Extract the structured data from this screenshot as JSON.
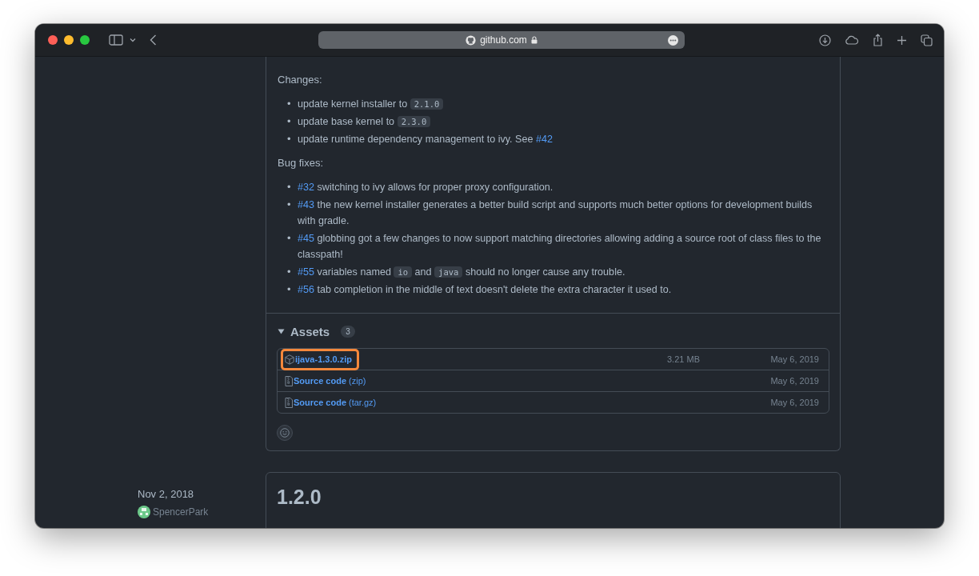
{
  "browser": {
    "address": "github.com"
  },
  "changes": {
    "heading": "Changes:",
    "items": [
      {
        "marker": "•",
        "segments": [
          {
            "kind": "text",
            "text": "update kernel installer to "
          },
          {
            "kind": "code",
            "text": "2.1.0"
          }
        ]
      },
      {
        "marker": "•",
        "segments": [
          {
            "kind": "text",
            "text": "update base kernel to "
          },
          {
            "kind": "code",
            "text": "2.3.0"
          }
        ]
      },
      {
        "marker": "•",
        "segments": [
          {
            "kind": "text",
            "text": "update runtime dependency management to ivy. See "
          },
          {
            "kind": "link",
            "text": "#42"
          }
        ]
      }
    ]
  },
  "bug_fixes": {
    "heading": "Bug fixes:",
    "items": [
      {
        "marker": "•",
        "segments": [
          {
            "kind": "link",
            "text": "#32"
          },
          {
            "kind": "text",
            "text": " switching to ivy allows for proper proxy configuration."
          }
        ]
      },
      {
        "marker": "•",
        "segments": [
          {
            "kind": "link",
            "text": "#43"
          },
          {
            "kind": "text",
            "text": " the new kernel installer generates a better build script and supports much better options for development builds with gradle."
          }
        ]
      },
      {
        "marker": "•",
        "segments": [
          {
            "kind": "link",
            "text": "#45"
          },
          {
            "kind": "text",
            "text": " globbing got a few changes to now support matching directories allowing adding a source root of class files to the classpath!"
          }
        ]
      },
      {
        "marker": "•",
        "segments": [
          {
            "kind": "link",
            "text": "#55"
          },
          {
            "kind": "text",
            "text": " variables named "
          },
          {
            "kind": "code",
            "text": "io"
          },
          {
            "kind": "text",
            "text": " and "
          },
          {
            "kind": "code",
            "text": "java"
          },
          {
            "kind": "text",
            "text": " should no longer cause any trouble."
          }
        ]
      },
      {
        "marker": "•",
        "segments": [
          {
            "kind": "link",
            "text": "#56"
          },
          {
            "kind": "text",
            "text": " tab completion in the middle of text doesn't delete the extra character it used to."
          }
        ]
      }
    ]
  },
  "assets": {
    "title": "Assets",
    "count": "3",
    "expanded": true,
    "items": [
      {
        "kind": "package",
        "name": "ijava-1.3.0.zip",
        "size": "3.21 MB",
        "date": "May 6, 2019",
        "highlighted": true
      },
      {
        "kind": "source",
        "name": "Source code",
        "suffix": "(zip)",
        "date": "May 6, 2019",
        "highlighted": false
      },
      {
        "kind": "source",
        "name": "Source code",
        "suffix": "(tar.gz)",
        "date": "May 6, 2019",
        "highlighted": false
      }
    ]
  },
  "next_release": {
    "date": "Nov 2, 2018",
    "author": "SpencerPark",
    "title": "1.2.0"
  }
}
